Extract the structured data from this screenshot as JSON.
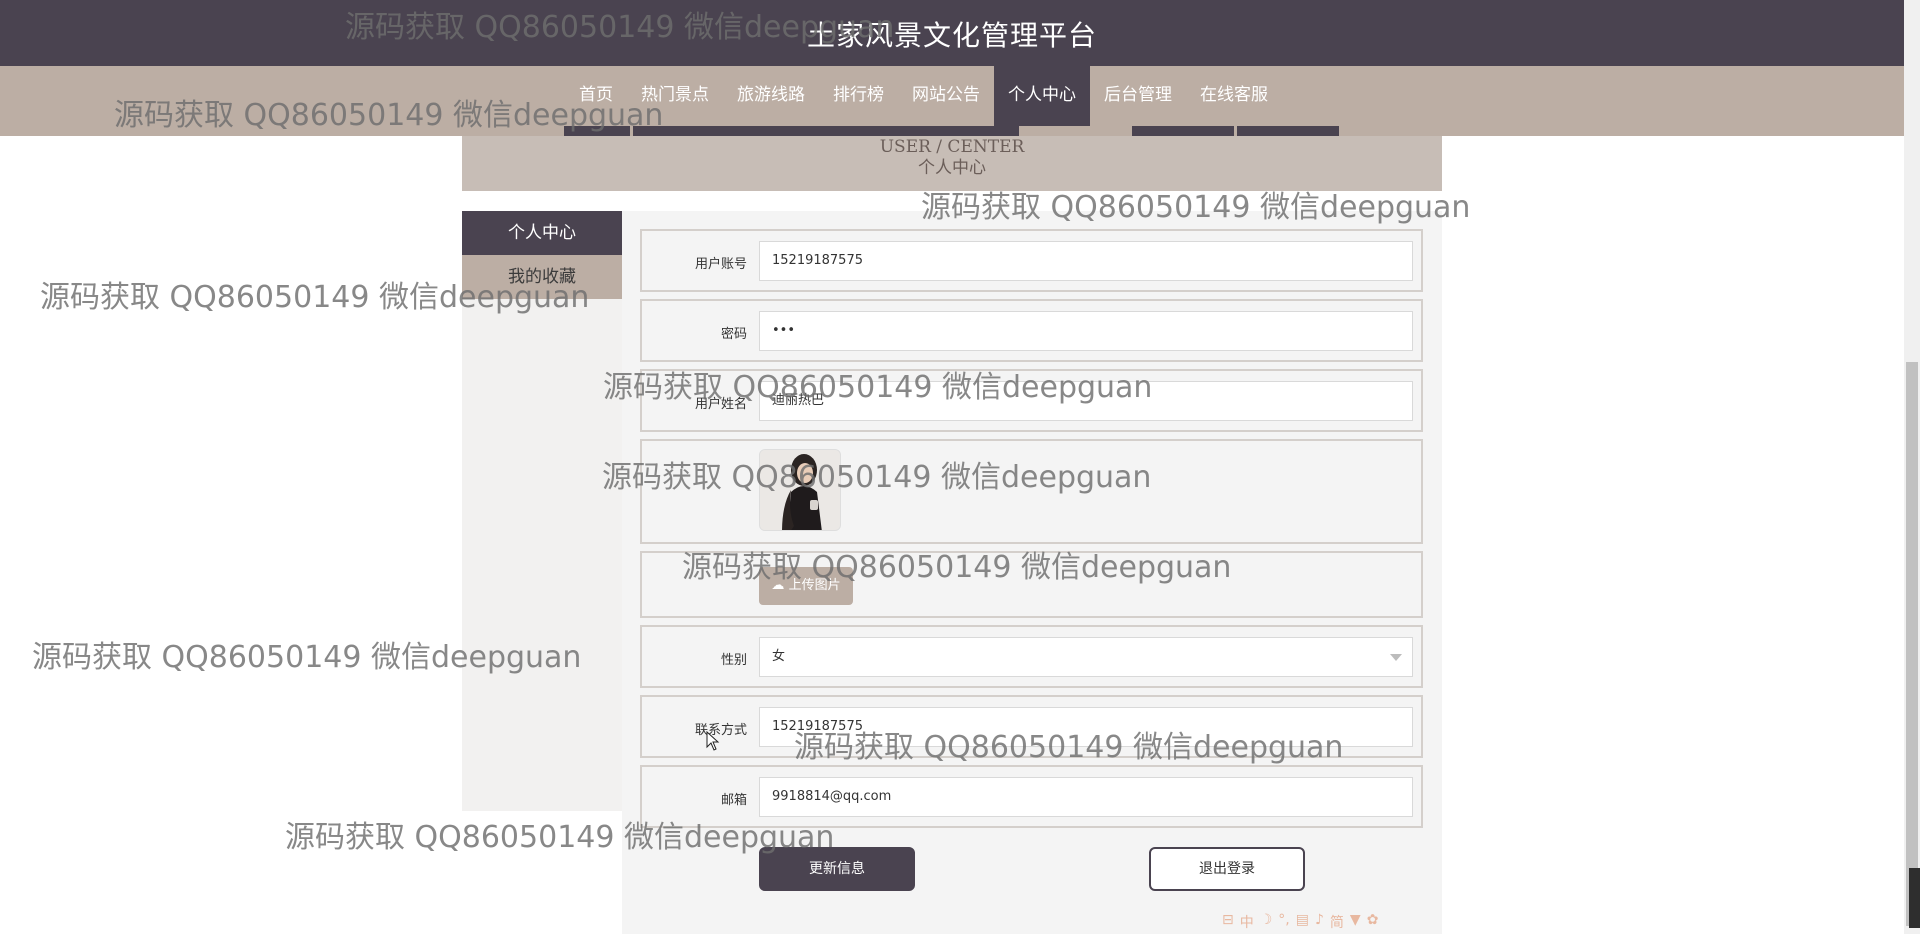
{
  "header": {
    "title": "土家风景文化管理平台"
  },
  "nav": {
    "items": [
      "首页",
      "热门景点",
      "旅游线路",
      "排行榜",
      "网站公告",
      "个人中心",
      "后台管理",
      "在线客服"
    ],
    "active": "个人中心"
  },
  "banner": {
    "en": "USER / CENTER",
    "cn": "个人中心"
  },
  "sidebar": {
    "items": [
      {
        "label": "个人中心",
        "active": true
      },
      {
        "label": "我的收藏",
        "active": false
      }
    ]
  },
  "form": {
    "account_label": "用户账号",
    "account_value": "15219187575",
    "password_label": "密码",
    "password_value": "•••",
    "name_label": "用户姓名",
    "name_value": "迪丽热巴",
    "upload_label": "上传图片",
    "gender_label": "性别",
    "gender_value": "女",
    "phone_label": "联系方式",
    "phone_value": "15219187575",
    "email_label": "邮箱",
    "email_value": "9918814@qq.com"
  },
  "buttons": {
    "update": "更新信息",
    "logout": "退出登录"
  },
  "watermark": "源码获取 QQ86050149 微信deepguan",
  "ime": {
    "cn": "中",
    "simplified": "简"
  },
  "colors": {
    "dark": "#4a4350",
    "taupe": "#bcaea4",
    "banner": "#c7bdb6"
  }
}
